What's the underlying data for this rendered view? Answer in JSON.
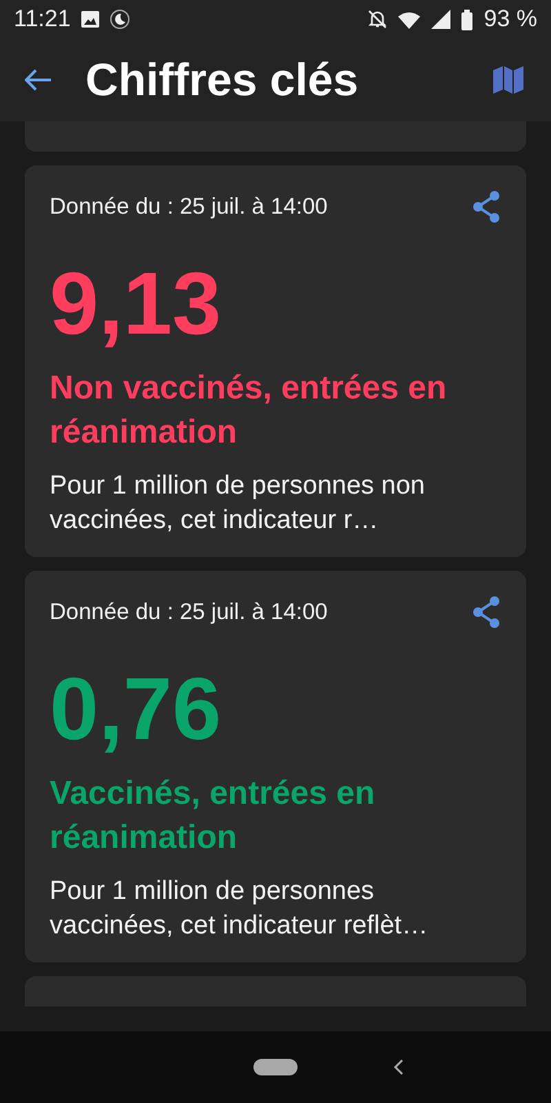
{
  "status_bar": {
    "time": "11:21",
    "battery": "93 %"
  },
  "header": {
    "title": "Chiffres clés"
  },
  "cards": [
    {
      "date": "Donnée du : 25 juil. à 14:00",
      "value": "9,13",
      "label": "Non vaccinés, entrées en réanimation",
      "color": "#ff3e5f",
      "description": "Pour 1 million de personnes non vaccinées, cet indicateur r…"
    },
    {
      "date": "Donnée du : 25 juil. à 14:00",
      "value": "0,76",
      "label": "Vaccinés, entrées en réanimation",
      "color": "#0aa56a",
      "description": "Pour 1 million de personnes vaccinées, cet indicateur reflèt…"
    }
  ]
}
